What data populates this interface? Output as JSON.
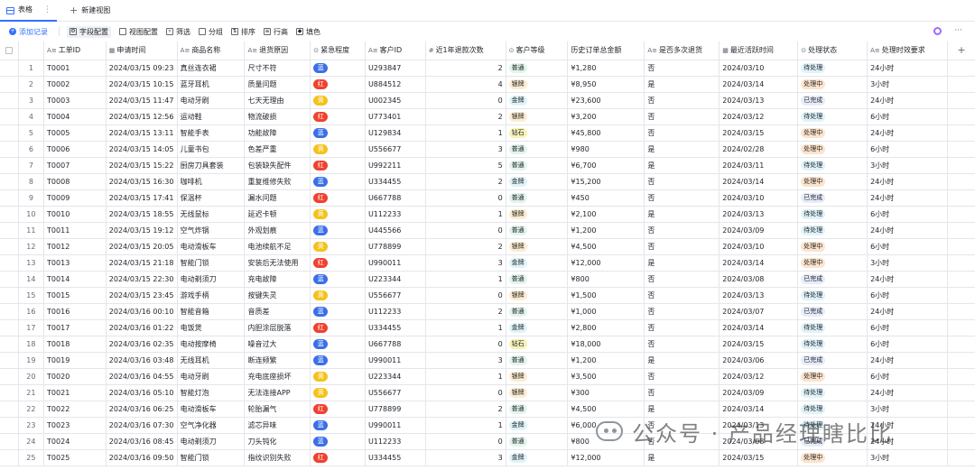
{
  "tabs": {
    "active": "表格",
    "new_view": "新建视图"
  },
  "toolbar": {
    "add_record": "添加记录",
    "field_config": "字段配置",
    "view_config": "视图配置",
    "filter": "筛选",
    "group": "分组",
    "sort": "排序",
    "row_height": "行高",
    "fill_color": "填色"
  },
  "columns": [
    "工单ID",
    "申请时间",
    "商品名称",
    "退货原因",
    "紧急程度",
    "客户ID",
    "近1年退款次数",
    "客户等级",
    "历史订单总金额",
    "是否多次退货",
    "最近活跃时间",
    "处理状态",
    "处理时效要求"
  ],
  "urgency_colors": {
    "蓝": "#3b6fe8",
    "红": "#f0412e",
    "黄": "#f5c21b"
  },
  "rows": [
    [
      "1",
      "T0001",
      "2024/03/15  09:23",
      "真丝连衣裙",
      "尺寸不符",
      "蓝",
      "U293847",
      "2",
      "普通",
      "¥1,280",
      "否",
      "2024/03/10",
      "待处理",
      "24小时"
    ],
    [
      "2",
      "T0002",
      "2024/03/15  10:15",
      "蓝牙耳机",
      "质量问题",
      "红",
      "U884512",
      "4",
      "银牌",
      "¥8,950",
      "是",
      "2024/03/14",
      "处理中",
      "3小时"
    ],
    [
      "3",
      "T0003",
      "2024/03/15  11:47",
      "电动牙刷",
      "七天无理由",
      "黄",
      "U002345",
      "0",
      "金牌",
      "¥23,600",
      "否",
      "2024/03/13",
      "已完成",
      "24小时"
    ],
    [
      "4",
      "T0004",
      "2024/03/15  12:56",
      "运动鞋",
      "物流破损",
      "红",
      "U773401",
      "2",
      "银牌",
      "¥3,200",
      "否",
      "2024/03/12",
      "待处理",
      "6小时"
    ],
    [
      "5",
      "T0005",
      "2024/03/15  13:11",
      "智能手表",
      "功能故障",
      "蓝",
      "U129834",
      "1",
      "钻石",
      "¥45,800",
      "否",
      "2024/03/15",
      "处理中",
      "24小时"
    ],
    [
      "6",
      "T0006",
      "2024/03/15  14:05",
      "儿童书包",
      "色差严重",
      "黄",
      "U556677",
      "3",
      "普通",
      "¥980",
      "是",
      "2024/02/28",
      "处理中",
      "6小时"
    ],
    [
      "7",
      "T0007",
      "2024/03/15  15:22",
      "厨房刀具套装",
      "包装缺失配件",
      "红",
      "U992211",
      "5",
      "普通",
      "¥6,700",
      "是",
      "2024/03/11",
      "待处理",
      "3小时"
    ],
    [
      "8",
      "T0008",
      "2024/03/15  16:30",
      "咖啡机",
      "重复维修失败",
      "蓝",
      "U334455",
      "2",
      "金牌",
      "¥15,200",
      "否",
      "2024/03/14",
      "处理中",
      "24小时"
    ],
    [
      "9",
      "T0009",
      "2024/03/15  17:41",
      "保温杯",
      "漏水问题",
      "红",
      "U667788",
      "0",
      "普通",
      "¥450",
      "否",
      "2024/03/10",
      "已完成",
      "24小时"
    ],
    [
      "10",
      "T0010",
      "2024/03/15  18:55",
      "无线鼠标",
      "延迟卡顿",
      "黄",
      "U112233",
      "1",
      "银牌",
      "¥2,100",
      "是",
      "2024/03/13",
      "待处理",
      "6小时"
    ],
    [
      "11",
      "T0011",
      "2024/03/15  19:12",
      "空气炸锅",
      "外观划痕",
      "蓝",
      "U445566",
      "0",
      "普通",
      "¥1,200",
      "否",
      "2024/03/09",
      "待处理",
      "24小时"
    ],
    [
      "12",
      "T0012",
      "2024/03/15  20:05",
      "电动滑板车",
      "电池续航不足",
      "黄",
      "U778899",
      "2",
      "银牌",
      "¥4,500",
      "否",
      "2024/03/10",
      "处理中",
      "6小时"
    ],
    [
      "13",
      "T0013",
      "2024/03/15  21:18",
      "智能门锁",
      "安装后无法使用",
      "红",
      "U990011",
      "3",
      "金牌",
      "¥12,000",
      "是",
      "2024/03/14",
      "处理中",
      "3小时"
    ],
    [
      "14",
      "T0014",
      "2024/03/15  22:30",
      "电动剃须刀",
      "充电故障",
      "蓝",
      "U223344",
      "1",
      "普通",
      "¥800",
      "否",
      "2024/03/08",
      "已完成",
      "24小时"
    ],
    [
      "15",
      "T0015",
      "2024/03/15  23:45",
      "游戏手柄",
      "按键失灵",
      "黄",
      "U556677",
      "0",
      "银牌",
      "¥1,500",
      "否",
      "2024/03/13",
      "待处理",
      "6小时"
    ],
    [
      "16",
      "T0016",
      "2024/03/16  00:10",
      "智能音箱",
      "音质差",
      "蓝",
      "U112233",
      "2",
      "普通",
      "¥1,000",
      "否",
      "2024/03/07",
      "已完成",
      "24小时"
    ],
    [
      "17",
      "T0017",
      "2024/03/16  01:22",
      "电饭煲",
      "内胆涂层脱落",
      "红",
      "U334455",
      "1",
      "金牌",
      "¥2,800",
      "否",
      "2024/03/14",
      "待处理",
      "6小时"
    ],
    [
      "18",
      "T0018",
      "2024/03/16  02:35",
      "电动按摩椅",
      "噪音过大",
      "蓝",
      "U667788",
      "0",
      "钻石",
      "¥18,000",
      "否",
      "2024/03/15",
      "待处理",
      "6小时"
    ],
    [
      "19",
      "T0019",
      "2024/03/16  03:48",
      "无线耳机",
      "断连频繁",
      "蓝",
      "U990011",
      "3",
      "普通",
      "¥1,200",
      "是",
      "2024/03/06",
      "已完成",
      "24小时"
    ],
    [
      "20",
      "T0020",
      "2024/03/16  04:55",
      "电动牙刷",
      "充电底座损坏",
      "黄",
      "U223344",
      "1",
      "银牌",
      "¥3,500",
      "否",
      "2024/03/12",
      "处理中",
      "6小时"
    ],
    [
      "21",
      "T0021",
      "2024/03/16  05:10",
      "智能灯泡",
      "无法连接APP",
      "黄",
      "U556677",
      "0",
      "银牌",
      "¥300",
      "否",
      "2024/03/09",
      "待处理",
      "24小时"
    ],
    [
      "22",
      "T0022",
      "2024/03/16  06:25",
      "电动滑板车",
      "轮胎漏气",
      "红",
      "U778899",
      "2",
      "普通",
      "¥4,500",
      "是",
      "2024/03/14",
      "待处理",
      "3小时"
    ],
    [
      "23",
      "T0023",
      "2024/03/16  07:30",
      "空气净化器",
      "滤芯异味",
      "蓝",
      "U990011",
      "1",
      "金牌",
      "¥6,000",
      "否",
      "2024/03/13",
      "待处理",
      "24小时"
    ],
    [
      "24",
      "T0024",
      "2024/03/16  08:45",
      "电动剃须刀",
      "刀头钝化",
      "蓝",
      "U112233",
      "0",
      "普通",
      "¥800",
      "否",
      "2024/03/08",
      "已完成",
      "24小时"
    ],
    [
      "25",
      "T0025",
      "2024/03/16  09:50",
      "智能门锁",
      "指纹识别失败",
      "红",
      "U334455",
      "3",
      "金牌",
      "¥12,000",
      "是",
      "2024/03/15",
      "处理中",
      "3小时"
    ]
  ],
  "watermark": "公众号 · 产品经理瞎比比"
}
